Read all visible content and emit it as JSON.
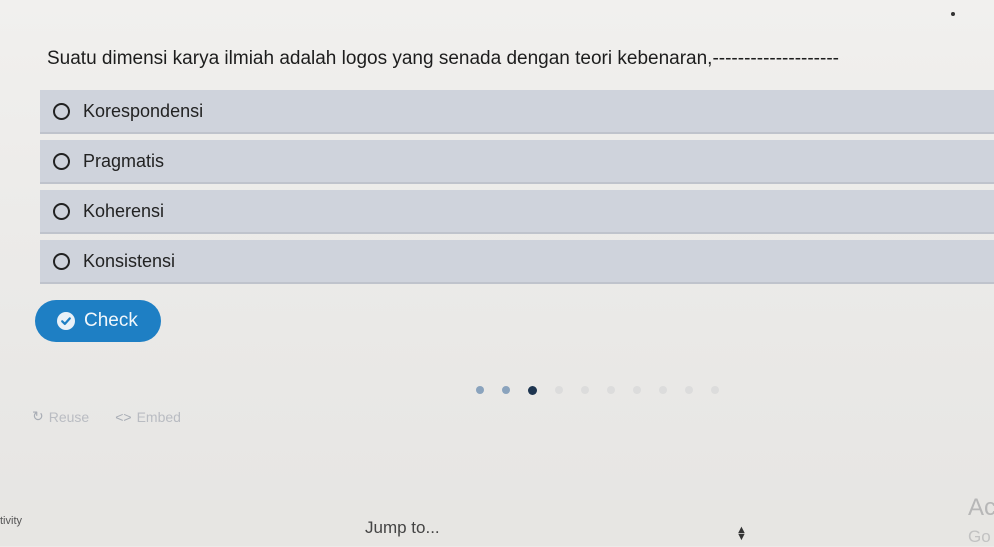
{
  "question": {
    "text": "Suatu dimensi karya ilmiah adalah logos yang senada dengan teori kebenaran,--------------------"
  },
  "options": [
    {
      "label": "Korespondensi",
      "selected": false
    },
    {
      "label": "Pragmatis",
      "selected": false
    },
    {
      "label": "Koherensi",
      "selected": false
    },
    {
      "label": "Konsistensi",
      "selected": false
    }
  ],
  "check_button": {
    "label": "Check",
    "color": "#1e7fc4"
  },
  "progress": {
    "total": 10,
    "current": 3
  },
  "footer": {
    "reuse_label": "Reuse",
    "embed_label": "Embed"
  },
  "bottom": {
    "activity_label": "tivity",
    "jump_label": "Jump to...",
    "ac_label": "Ac",
    "go_label": "Go"
  },
  "icons": {
    "reuse": "refresh-icon",
    "embed": "code-icon",
    "check": "checkmark-circle-icon"
  }
}
